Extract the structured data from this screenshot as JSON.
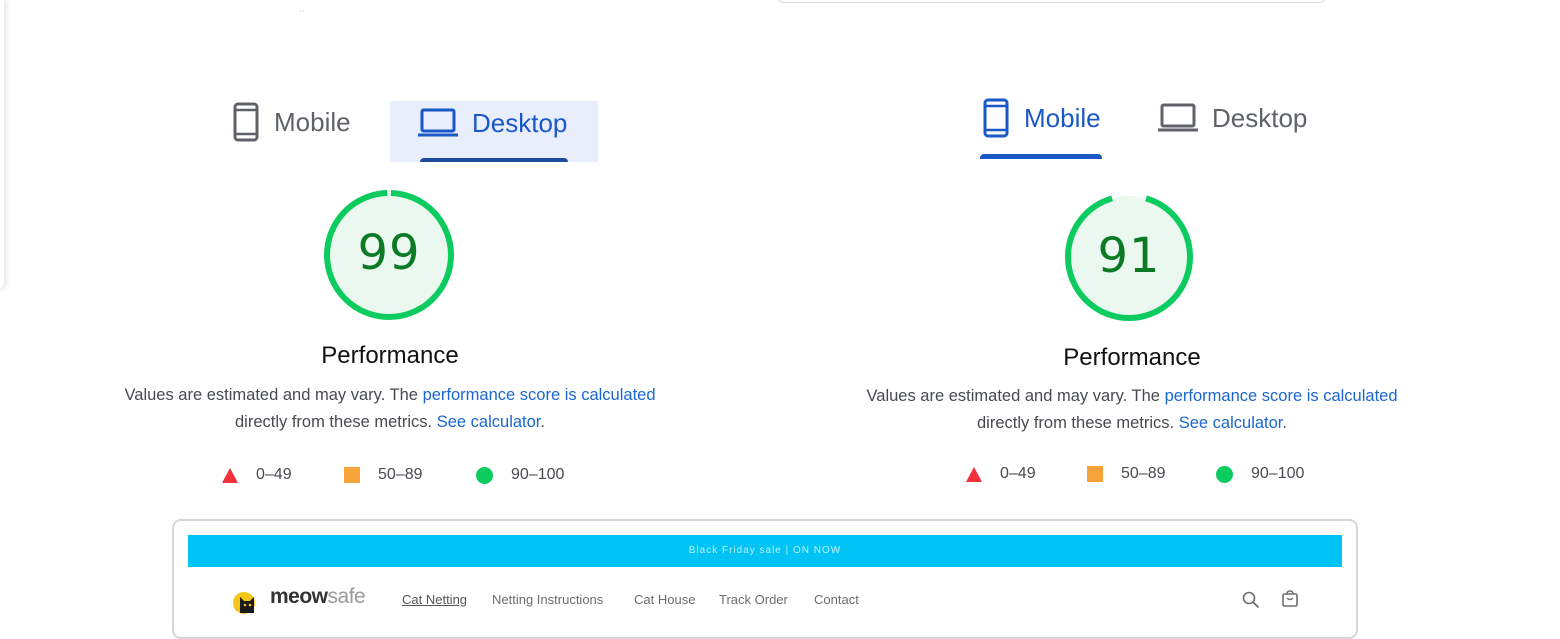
{
  "left_panel": {
    "tabs": [
      {
        "label": "Mobile",
        "icon": "phone-icon",
        "active": false
      },
      {
        "label": "Desktop",
        "icon": "laptop-icon",
        "active": true
      }
    ],
    "score": "99",
    "score_value": 99,
    "title": "Performance",
    "desc_text_1": "Values are estimated and may vary. The",
    "desc_link_1": "performance score is calculated",
    "desc_text_2": "directly from these metrics.",
    "desc_link_2": "See calculator",
    "desc_period": "."
  },
  "right_panel": {
    "tabs": [
      {
        "label": "Mobile",
        "icon": "phone-icon",
        "active": true
      },
      {
        "label": "Desktop",
        "icon": "laptop-icon",
        "active": false
      }
    ],
    "score": "91",
    "score_value": 91,
    "title": "Performance",
    "desc_text_1": "Values are estimated and may vary. The",
    "desc_link_1": "performance score is calculated",
    "desc_text_2": "directly from these metrics.",
    "desc_link_2": "See calculator",
    "desc_period": "."
  },
  "legend": {
    "fail": "0–49",
    "average": "50–89",
    "pass": "90–100"
  },
  "colors": {
    "fail": "#f0303a",
    "average": "#f6a33a",
    "pass": "#0ccb5f",
    "active_tab": "#1a57c7",
    "link": "#1a67d2",
    "promo_bar": "#00c3f5"
  },
  "preview": {
    "promo_text": "Black Friday sale | ON NOW",
    "logo_main": "meow",
    "logo_suffix": "safe",
    "nav": [
      "Cat Netting",
      "Netting Instructions",
      "Cat House",
      "Track Order",
      "Contact"
    ],
    "icons": [
      "search-icon",
      "cart-icon"
    ]
  }
}
